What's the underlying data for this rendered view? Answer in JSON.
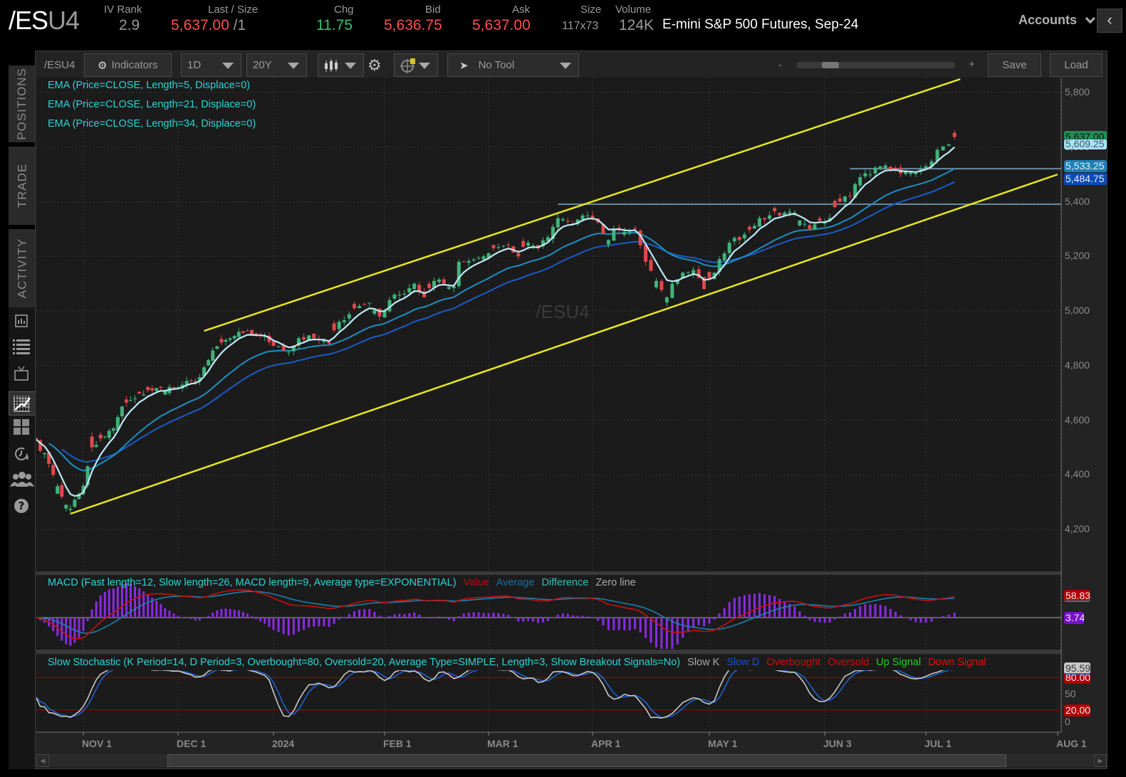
{
  "header": {
    "symbol_prefix": "/ES",
    "symbol_suffix": "U4",
    "iv_rank_label": "IV Rank",
    "iv_rank": "2.9",
    "last_label": "Last / Size",
    "last": "5,637.00",
    "last_size": "/1",
    "chg_label": "Chg",
    "chg": "11.75",
    "bid_label": "Bid",
    "bid": "5,636.75",
    "ask_label": "Ask",
    "ask": "5,637.00",
    "size_label": "Size",
    "size": "117x73",
    "volume_label": "Volume",
    "volume": "124K",
    "description": "E-mini S&P 500 Futures, Sep-24",
    "accounts_label": "Accounts"
  },
  "sidebar": {
    "tabs": [
      "POSITIONS",
      "TRADE",
      "ACTIVITY"
    ],
    "icons": [
      "news-icon",
      "list-icon",
      "tv-icon",
      "chart-icon",
      "grid-icon",
      "history-icon",
      "community-icon",
      "help-icon"
    ],
    "active_icon": "chart-icon"
  },
  "toolbar": {
    "symbol": "/ESU4",
    "indicators": "Indicators",
    "aggregation": "1D",
    "period": "20Y",
    "drawing_tool": "No Tool",
    "zoom_minus": "-",
    "zoom_plus": "+",
    "zoom_level": 0.16,
    "save": "Save",
    "load": "Load"
  },
  "studies": {
    "ema5": "EMA (Price=CLOSE, Length=5, Displace=0)",
    "ema21": "EMA (Price=CLOSE, Length=21, Displace=0)",
    "ema34": "EMA (Price=CLOSE, Length=34, Displace=0)",
    "macd": {
      "title": "MACD (Fast length=12, Slow length=26, MACD length=9, Average type=EXPONENTIAL)",
      "value": "Value",
      "average": "Average",
      "difference": "Difference",
      "zero": "Zero line"
    },
    "stoch": {
      "title": "Slow Stochastic (K Period=14, D Period=3, Overbought=80, Oversold=20, Average Type=SIMPLE, Length=3, Show Breakout Signals=No)",
      "slowk": "Slow K",
      "slowd": "Slow D",
      "overbought": "Overbought",
      "oversold": "Oversold",
      "up": "Up Signal",
      "down": "Down Signal"
    }
  },
  "watermark": "/ESU4",
  "price_labels": {
    "last": "5,637.00",
    "ema5": "5,609.25",
    "ema21": "5,533.25",
    "ema34": "5,484.75",
    "macd_value": "58.83",
    "macd_diff": "3.74",
    "stoch_k": "95.59",
    "overbought": "80.00",
    "oversold": "20.00"
  },
  "colors": {
    "up": "#3fb37a",
    "down": "#e0474c",
    "ema5": "#bfe9f7",
    "ema21": "#1d8fc2",
    "ema34": "#1a5cc8",
    "channel": "#e8e81a",
    "hline": "#6a8aa0",
    "macd_value": "#c81010",
    "macd_avg": "#1a7fb0",
    "macd_diff": "#8a2be2",
    "stoch_k": "#c8c8c8",
    "stoch_d": "#2060d0"
  },
  "chart_data": {
    "type": "candlestick",
    "y_ticks": [
      "5,800",
      "5,600",
      "5,400",
      "5,200",
      "5,000",
      "4,800",
      "4,600",
      "4,400",
      "4,200"
    ],
    "ylim": [
      4200,
      5800
    ],
    "x_ticks": [
      "NOV 1",
      "DEC 1",
      "2024",
      "FEB 1",
      "MAR 1",
      "APR 1",
      "MAY 1",
      "JUN 3",
      "JUL 1",
      "AUG 1"
    ],
    "stoch_ticks": [
      "50",
      "0"
    ],
    "grid": true,
    "approx_closes": [
      [
        "2023-10-17",
        4530
      ],
      [
        "2023-10-20",
        4440
      ],
      [
        "2023-10-23",
        4400
      ],
      [
        "2023-10-26",
        4290
      ],
      [
        "2023-10-27",
        4276
      ],
      [
        "2023-10-31",
        4330
      ],
      [
        "2023-11-01",
        4360
      ],
      [
        "2023-11-03",
        4500
      ],
      [
        "2023-11-08",
        4540
      ],
      [
        "2023-11-10",
        4570
      ],
      [
        "2023-11-14",
        4650
      ],
      [
        "2023-11-17",
        4680
      ],
      [
        "2023-11-22",
        4710
      ],
      [
        "2023-12-01",
        4720
      ],
      [
        "2023-12-04",
        4730
      ],
      [
        "2023-12-07",
        4740
      ],
      [
        "2023-12-12",
        4820
      ],
      [
        "2023-12-14",
        4870
      ],
      [
        "2023-12-19",
        4900
      ],
      [
        "2023-12-22",
        4920
      ],
      [
        "2023-12-28",
        4910
      ],
      [
        "2024-01-03",
        4870
      ],
      [
        "2024-01-05",
        4850
      ],
      [
        "2024-01-09",
        4900
      ],
      [
        "2024-01-12",
        4900
      ],
      [
        "2024-01-17",
        4880
      ],
      [
        "2024-01-19",
        4960
      ],
      [
        "2024-01-24",
        5010
      ],
      [
        "2024-01-29",
        5030
      ],
      [
        "2024-01-31",
        4980
      ],
      [
        "2024-02-02",
        5040
      ],
      [
        "2024-02-06",
        5060
      ],
      [
        "2024-02-09",
        5100
      ],
      [
        "2024-02-13",
        5050
      ],
      [
        "2024-02-15",
        5110
      ],
      [
        "2024-02-21",
        5090
      ],
      [
        "2024-02-22",
        5180
      ],
      [
        "2024-02-29",
        5200
      ],
      [
        "2024-03-04",
        5230
      ],
      [
        "2024-03-07",
        5240
      ],
      [
        "2024-03-11",
        5200
      ],
      [
        "2024-03-13",
        5250
      ],
      [
        "2024-03-15",
        5230
      ],
      [
        "2024-03-19",
        5270
      ],
      [
        "2024-03-21",
        5340
      ],
      [
        "2024-03-26",
        5320
      ],
      [
        "2024-03-28",
        5350
      ],
      [
        "2024-04-01",
        5340
      ],
      [
        "2024-04-04",
        5260
      ],
      [
        "2024-04-05",
        5300
      ],
      [
        "2024-04-09",
        5290
      ],
      [
        "2024-04-11",
        5300
      ],
      [
        "2024-04-12",
        5240
      ],
      [
        "2024-04-15",
        5180
      ],
      [
        "2024-04-17",
        5110
      ],
      [
        "2024-04-19",
        5050
      ],
      [
        "2024-04-22",
        5100
      ],
      [
        "2024-04-24",
        5140
      ],
      [
        "2024-04-26",
        5150
      ],
      [
        "2024-04-30",
        5080
      ],
      [
        "2024-05-02",
        5140
      ],
      [
        "2024-05-03",
        5190
      ],
      [
        "2024-05-07",
        5250
      ],
      [
        "2024-05-10",
        5280
      ],
      [
        "2024-05-15",
        5340
      ],
      [
        "2024-05-17",
        5350
      ],
      [
        "2024-05-22",
        5360
      ],
      [
        "2024-05-24",
        5360
      ],
      [
        "2024-05-29",
        5300
      ],
      [
        "2024-05-31",
        5330
      ],
      [
        "2024-06-04",
        5340
      ],
      [
        "2024-06-06",
        5400
      ],
      [
        "2024-06-10",
        5420
      ],
      [
        "2024-06-12",
        5490
      ],
      [
        "2024-06-14",
        5500
      ],
      [
        "2024-06-18",
        5530
      ],
      [
        "2024-06-21",
        5520
      ],
      [
        "2024-06-25",
        5510
      ],
      [
        "2024-06-28",
        5520
      ],
      [
        "2024-07-01",
        5530
      ],
      [
        "2024-07-03",
        5590
      ],
      [
        "2024-07-05",
        5610
      ],
      [
        "2024-07-08",
        5637
      ]
    ],
    "drawings": {
      "channel_upper": [
        [
          "2023-12-11",
          4927
        ],
        [
          "2024-07-09",
          5849
        ]
      ],
      "channel_lower": [
        [
          "2023-10-27",
          4257
        ],
        [
          "2024-08-01",
          5500
        ]
      ],
      "hlines": [
        [
          "2024-03-21",
          5391
        ],
        [
          "2024-06-10",
          5521
        ]
      ]
    }
  }
}
